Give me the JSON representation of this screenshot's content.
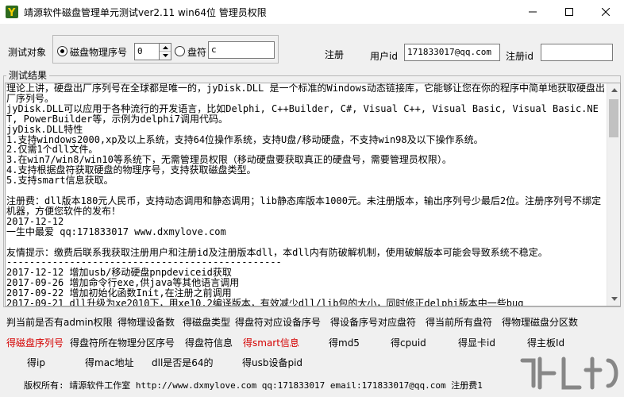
{
  "window": {
    "title": "靖源软件磁盘管理单元测试ver2.11 win64位 管理员权限"
  },
  "controls": {
    "test_object_label": "测试对象",
    "radio_disk_label": "磁盘物理序号",
    "disk_index_value": "0",
    "radio_drive_label": "盘符",
    "drive_value": "c",
    "register_label": "注册",
    "userid_label": "用户id",
    "userid_value": "171833017@qq.com",
    "regid_label": "注册id",
    "regid_value": ""
  },
  "result": {
    "caption": "测试结果",
    "text": "理论上讲，硬盘出厂序列号在全球都是唯一的，jyDisk.DLL 是一个标准的Windows动态链接库，它能够让您在你的程序中简单地获取硬盘出厂序列号。\njyDisk.DLL可以应用于各种流行的开发语言，比如Delphi, C++Builder, C#, Visual C++, Visual Basic, Visual Basic.NET, PowerBuilder等，示例为delphi7调用代码。\njyDisk.DLL特性\n1.支持windows2000,xp及以上系统，支持64位操作系统，支持U盘/移动硬盘，不支持win98及以下操作系统。\n2.仅需1个dll文件。\n3.在win7/win8/win10等系统下，无需管理员权限（移动硬盘要获取真正的硬盘号，需要管理员权限）。\n4.支持根据盘符获取硬盘的物理序号，支持获取磁盘类型。\n5.支持smart信息获取。\n\n注册费：dll版本180元人民币，支持动态调用和静态调用；lib静态库版本1000元。未注册版本，输出序列号少最后2位。注册序列号不绑定机器，方便您软件的发布！\n2017-12-12\n一生中最爱 qq:171833017 www.dxmylove.com\n\n友情提示：缴费后联系我获取注册用户和注册id及注册版本dll，本dll内有防破解机制，使用破解版本可能会导致系统不稳定。\n------------------------------------------------\n2017-12-12 增加usb/移动硬盘pnpdeviceid获取\n2017-09-26 增加命令行exe,供java等其他语言调用\n2017-09-22 增加初始化函数Init,在注册之前调用\n2017-09-21 dll升级为xe2010下，用xe10.2编译版本，有效减少dll/lib包的大小，同时修正delphi版本中一些bug"
  },
  "functions": {
    "row1": [
      "判当前是否有admin权限",
      "得物理设备数",
      "得磁盘类型",
      "得盘符对应设备序号",
      "得设备序号对应盘符",
      "得当前所有盘符",
      "得物理磁盘分区数"
    ],
    "row2": [
      "得磁盘序列号",
      "得盘符所在物理分区序号",
      "得盘符信息",
      "得smart信息",
      "得md5",
      "得cpuid",
      "得显卡id",
      "得主板Id"
    ],
    "row3": [
      "得ip",
      "得mac地址",
      "dll是否是64的",
      "得usb设备pid"
    ]
  },
  "footer": {
    "text": "版权所有: 靖源软件工作室 http://www.dxmylove.com qq:171833017 email:171833017@qq.com 注册费1"
  },
  "colors": {
    "highlight": "#d40000",
    "background": "#f0f0f0"
  },
  "icons": {
    "app": "app-logo-icon",
    "minimize": "minimize-icon",
    "maximize": "maximize-icon",
    "close": "close-icon",
    "watermark": "download-site-watermark"
  }
}
